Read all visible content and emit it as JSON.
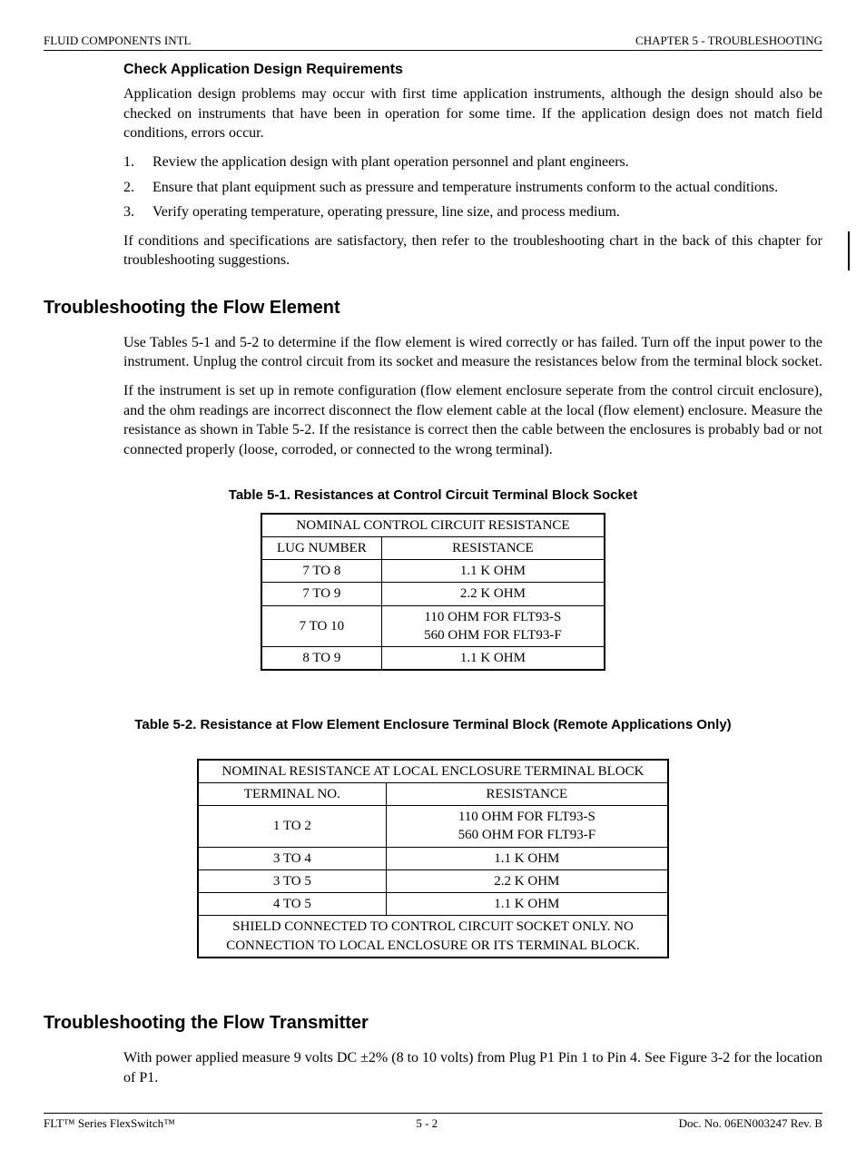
{
  "header": {
    "left": "FLUID COMPONENTS INTL",
    "right": "CHAPTER  5 - TROUBLESHOOTING"
  },
  "footer": {
    "left": "FLT™  Series FlexSwitch™",
    "center": "5 - 2",
    "right": "Doc. No. 06EN003247 Rev. B"
  },
  "sec1": {
    "heading": "Check Application Design Requirements",
    "intro": "Application design problems may occur with first time application instruments, although the design should also be checked on instruments that have been in operation for some time.  If the application design does not match field conditions, errors occur.",
    "items": [
      "Review the application design with plant operation personnel and plant engineers.",
      "Ensure that plant equipment such as pressure and temperature instruments conform to the actual conditions.",
      "Verify operating temperature, operating pressure, line size, and process medium."
    ],
    "outro": "If conditions and specifications are satisfactory, then refer to the troubleshooting chart in the back of this chapter for troubleshooting suggestions."
  },
  "sec2": {
    "heading": "Troubleshooting the Flow Element",
    "p1": "Use Tables 5-1 and 5-2 to determine if the flow element is wired correctly or has failed.  Turn off the input power to the instrument.  Unplug the control circuit from its socket and measure the resistances below from the terminal block socket.",
    "p2": "If the instrument is set up in remote configuration (flow element enclosure seperate from the control circuit enclosure), and the ohm readings are incorrect disconnect the flow element cable at the local (flow element) enclosure.  Measure the resistance as shown in Table 5-2. If the resistance is correct then the cable between the enclosures is probably bad or not connected properly (loose, corroded, or connected to the wrong terminal)."
  },
  "table1": {
    "caption": "Table 5-1.  Resistances at Control Circuit Terminal Block Socket",
    "title": "NOMINAL CONTROL CIRCUIT RESISTANCE",
    "col1": "LUG NUMBER",
    "col2": "RESISTANCE",
    "rows": [
      {
        "c1": "7 TO 8",
        "c2": "1.1 K OHM"
      },
      {
        "c1": "7 TO 9",
        "c2": "2.2 K OHM"
      },
      {
        "c1": "7 TO 10",
        "c2a": "110 OHM FOR FLT93-S",
        "c2b": "560 OHM FOR FLT93-F"
      },
      {
        "c1": "8 TO 9",
        "c2": "1.1 K OHM"
      }
    ]
  },
  "table2": {
    "caption": "Table 5-2.  Resistance at Flow Element Enclosure Terminal Block (Remote Applications Only)",
    "title": "NOMINAL RESISTANCE AT LOCAL ENCLOSURE TERMINAL BLOCK",
    "col1": "TERMINAL NO.",
    "col2": "RESISTANCE",
    "rows": [
      {
        "c1": "1 TO 2",
        "c2a": "110 OHM FOR FLT93-S",
        "c2b": "560 OHM FOR FLT93-F"
      },
      {
        "c1": "3 TO 4",
        "c2": "1.1 K OHM"
      },
      {
        "c1": "3 TO 5",
        "c2": "2.2 K OHM"
      },
      {
        "c1": "4 TO 5",
        "c2": "1.1 K OHM"
      }
    ],
    "note": "SHIELD CONNECTED TO CONTROL CIRCUIT SOCKET ONLY.  NO CONNECTION TO LOCAL ENCLOSURE OR ITS TERMINAL BLOCK."
  },
  "sec3": {
    "heading": "Troubleshooting the Flow Transmitter",
    "p1": "With power applied measure 9 volts DC ±2% (8 to 10 volts) from Plug P1 Pin 1 to Pin 4. See Figure 3-2 for the location of P1."
  }
}
